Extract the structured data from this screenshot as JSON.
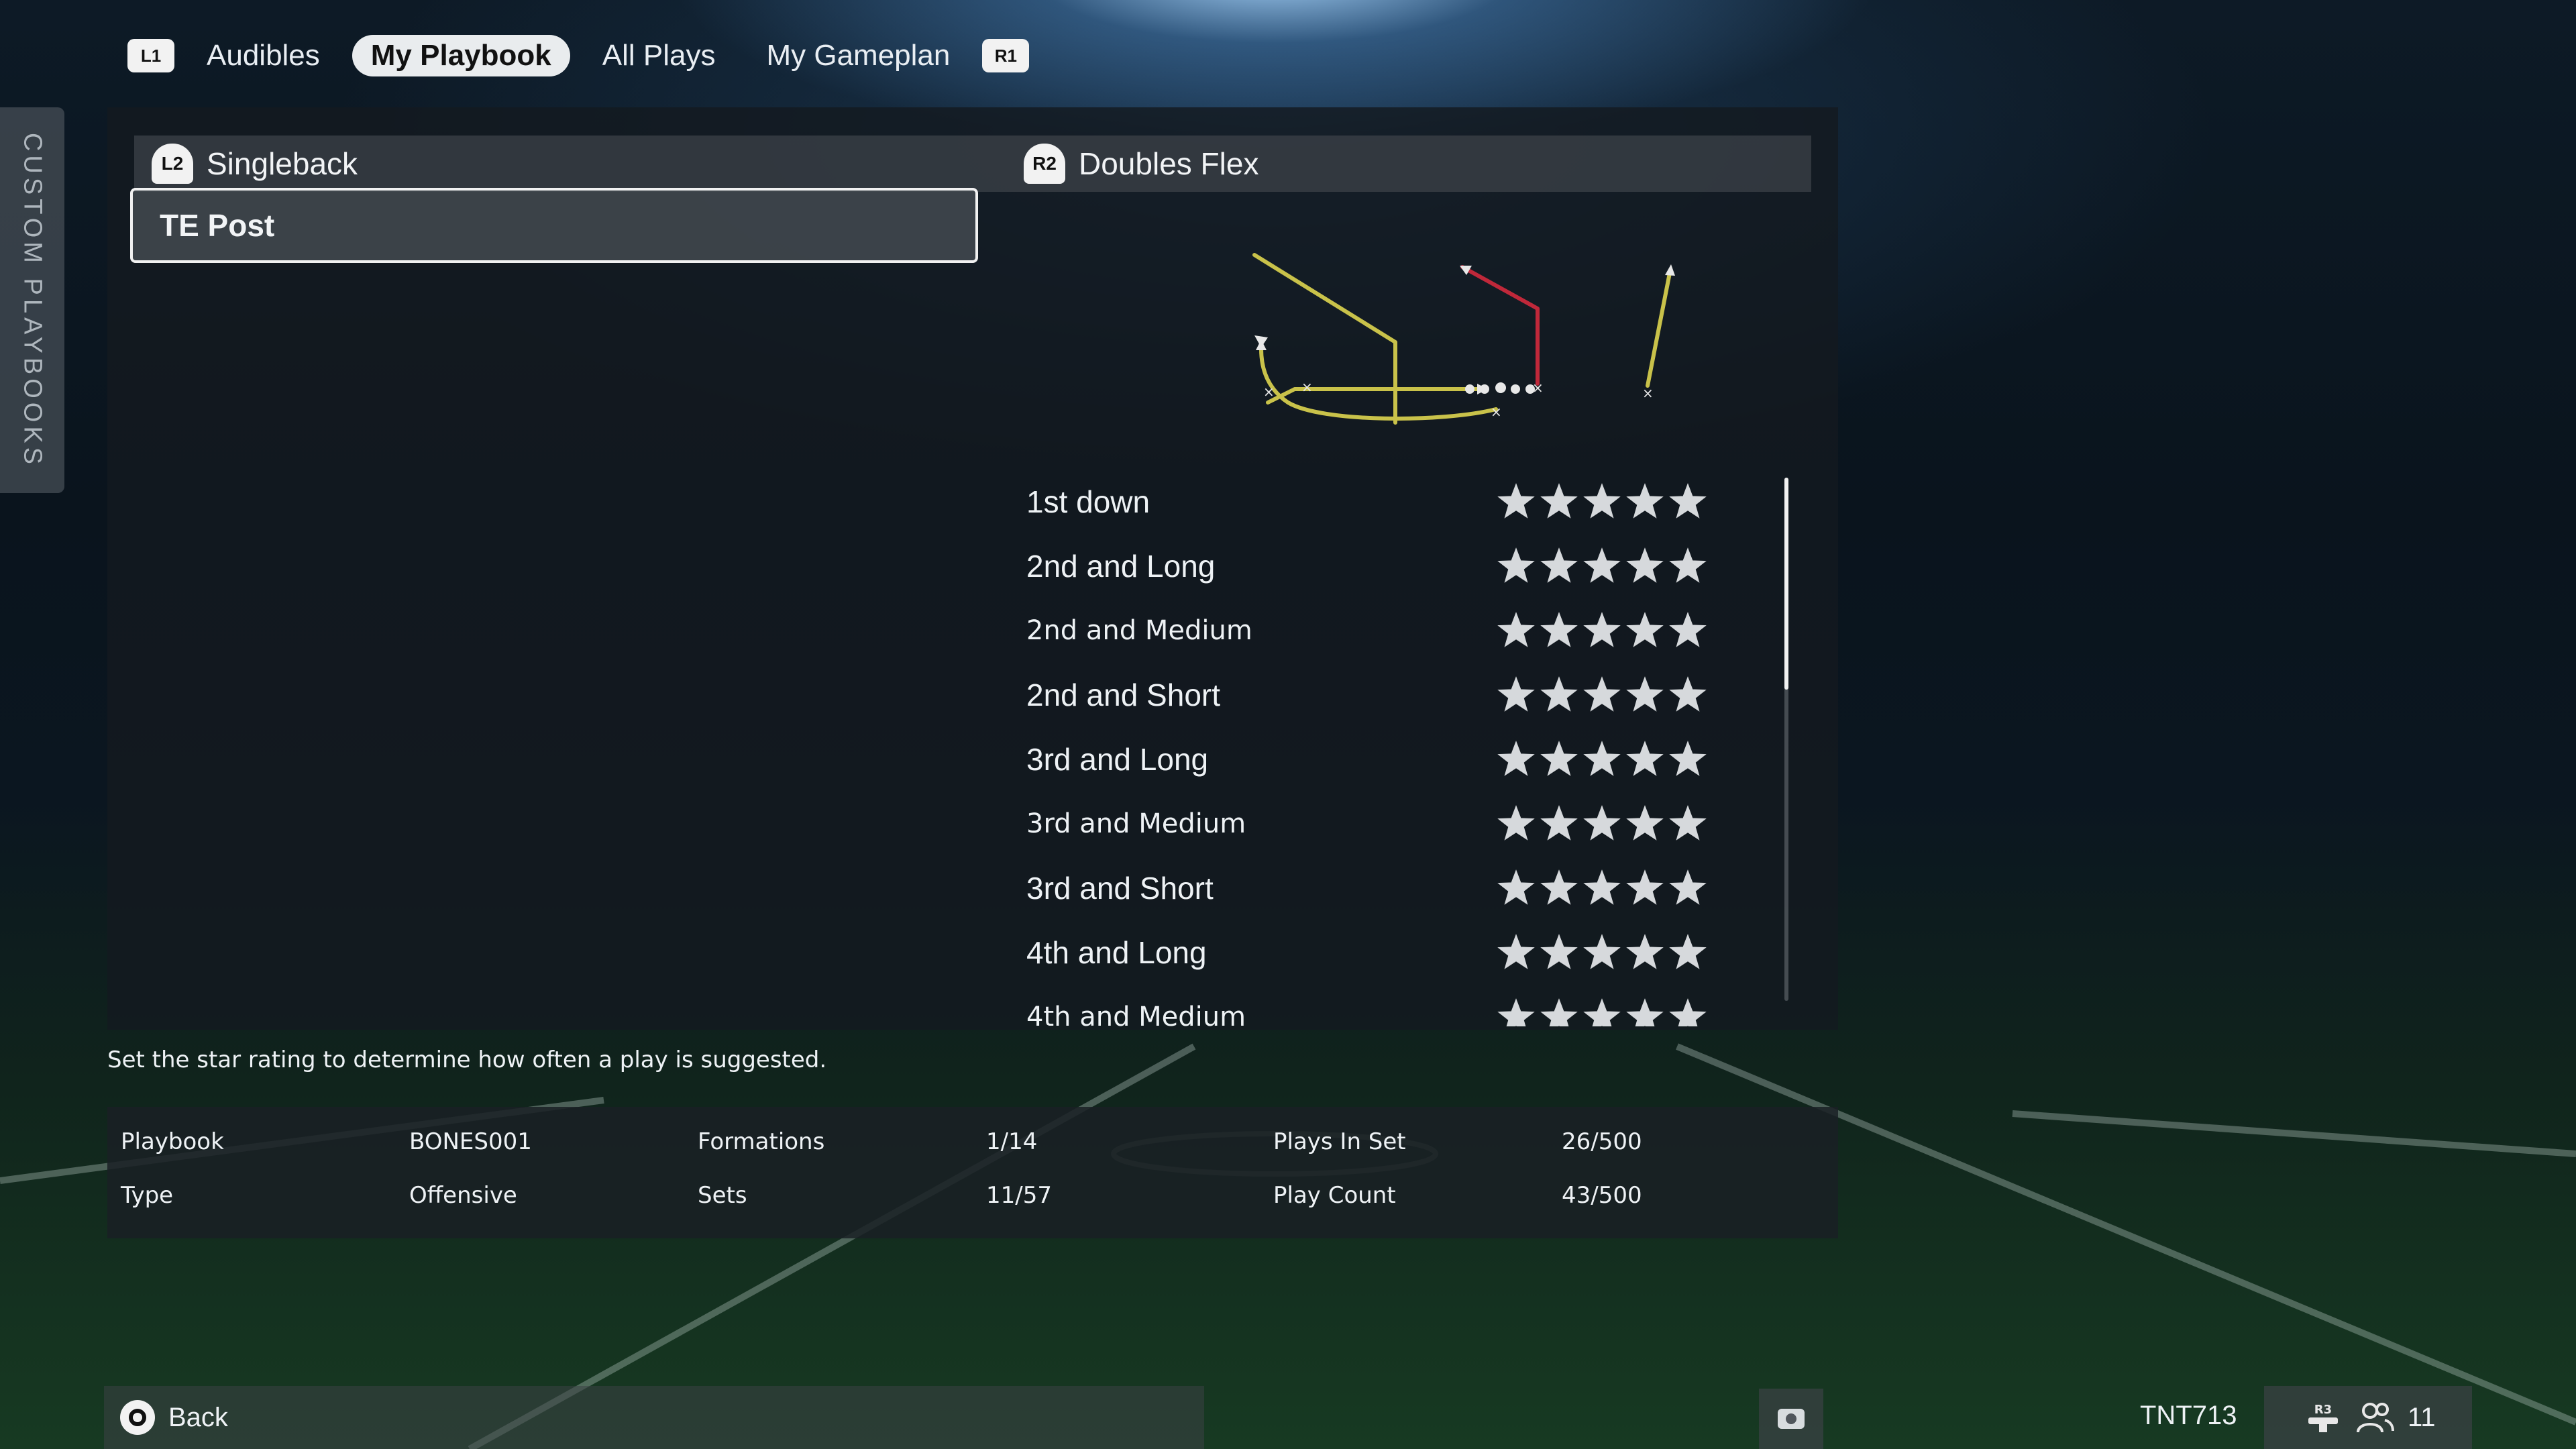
{
  "top_nav": {
    "left_button": "L1",
    "right_button": "R1",
    "tabs": [
      {
        "label": "Audibles",
        "active": false
      },
      {
        "label": "My Playbook",
        "active": true
      },
      {
        "label": "All Plays",
        "active": false
      },
      {
        "label": "My Gameplan",
        "active": false
      }
    ]
  },
  "sidebar": {
    "label": "CUSTOM PLAYBOOKS"
  },
  "formation": {
    "button": "L2",
    "name": "Singleback"
  },
  "set": {
    "button": "R2",
    "name": "Doubles Flex"
  },
  "selected_play": "TE Post",
  "ratings": [
    {
      "situation": "1st down",
      "stars": 5
    },
    {
      "situation": "2nd and Long",
      "stars": 5
    },
    {
      "situation": "2nd and Medium",
      "stars": 5
    },
    {
      "situation": "2nd and Short",
      "stars": 5
    },
    {
      "situation": "3rd and Long",
      "stars": 5
    },
    {
      "situation": "3rd and Medium",
      "stars": 5
    },
    {
      "situation": "3rd and Short",
      "stars": 5
    },
    {
      "situation": "4th and Long",
      "stars": 5
    },
    {
      "situation": "4th and Medium",
      "stars": 5
    }
  ],
  "hint": "Set the star rating to determine how often a play is suggested.",
  "info": {
    "playbook_label": "Playbook",
    "playbook_value": "BONES001",
    "type_label": "Type",
    "type_value": "Offensive",
    "formations_label": "Formations",
    "formations_value": "1/14",
    "sets_label": "Sets",
    "sets_value": "11/57",
    "plays_in_set_label": "Plays In Set",
    "plays_in_set_value": "26/500",
    "play_count_label": "Play Count",
    "play_count_value": "43/500"
  },
  "footer": {
    "back_label": "Back",
    "gamertag": "TNT713",
    "party_button": "R3",
    "party_count": "11"
  },
  "colors": {
    "route_yellow": "#c9c24a",
    "route_red": "#c0283a",
    "star": "#d6d9dc"
  }
}
